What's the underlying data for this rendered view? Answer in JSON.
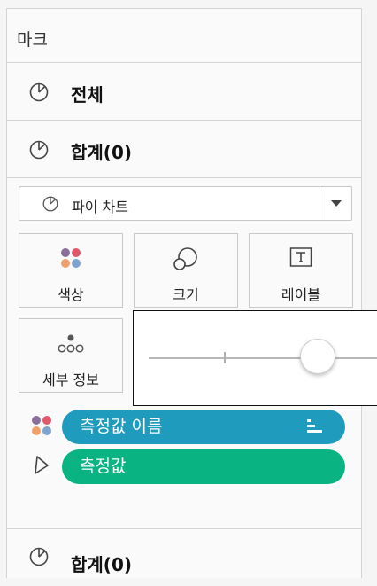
{
  "panel": {
    "title": "마크",
    "rows": [
      {
        "label": "전체",
        "icon": "pie-icon"
      },
      {
        "label": "합계(0)",
        "icon": "pie-icon"
      }
    ],
    "bottom_row": {
      "label": "합계(0)",
      "icon": "pie-icon"
    }
  },
  "mark_type": {
    "value": "파이 차트",
    "icon": "pie-icon"
  },
  "tiles": {
    "color": "색상",
    "size": "크기",
    "label": "레이블",
    "detail": "세부 정보"
  },
  "size_slider": {
    "level": 0.78
  },
  "shelf": [
    {
      "label": "측정값 이름",
      "color": "#1f9bbd",
      "icon": "color-dots-icon"
    },
    {
      "label": "측정값",
      "color": "#0ab482",
      "icon": "angle-icon"
    }
  ],
  "colors": {
    "dot_purple": "#8a6e9c",
    "dot_red": "#e0596b",
    "dot_orange": "#f0a06a",
    "dot_blue": "#7ea3cf"
  }
}
